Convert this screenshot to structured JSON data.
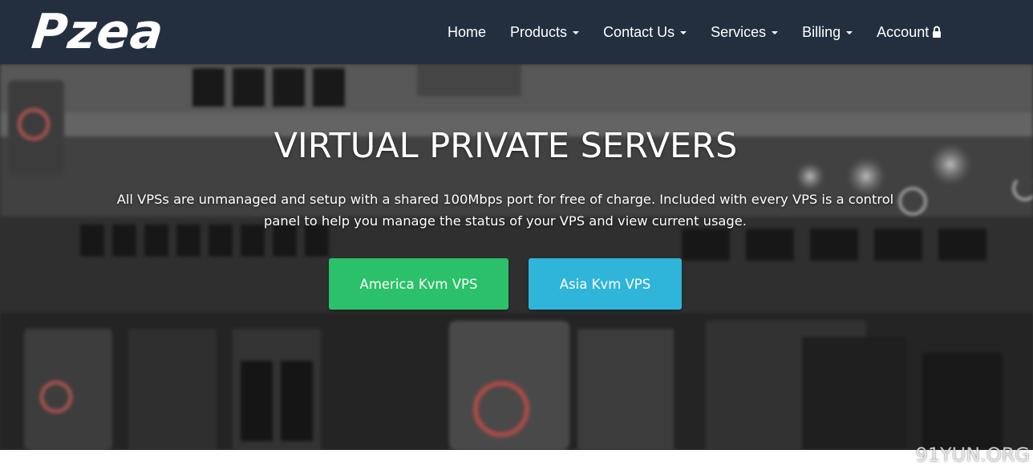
{
  "brand": {
    "logo_text": "Pzea"
  },
  "nav": {
    "items": [
      {
        "label": "Home",
        "has_caret": false
      },
      {
        "label": "Products",
        "has_caret": true
      },
      {
        "label": "Contact Us",
        "has_caret": true
      },
      {
        "label": "Services",
        "has_caret": true
      },
      {
        "label": "Billing",
        "has_caret": true
      },
      {
        "label": "Account",
        "icon": "lock-icon"
      }
    ]
  },
  "hero": {
    "title": "VIRTUAL PRIVATE SERVERS",
    "description": "All VPSs are unmanaged and setup with a shared 100Mbps port for free of charge. Included with every VPS is a control panel to help you manage the status of your VPS and view current usage.",
    "buttons": [
      {
        "label": "America Kvm VPS",
        "color": "#2ac16a"
      },
      {
        "label": "Asia Kvm VPS",
        "color": "#2fb5d9"
      }
    ]
  },
  "watermark": "91YUN.ORG",
  "colors": {
    "navbar_bg": "#232f3f",
    "text": "#ffffff"
  }
}
